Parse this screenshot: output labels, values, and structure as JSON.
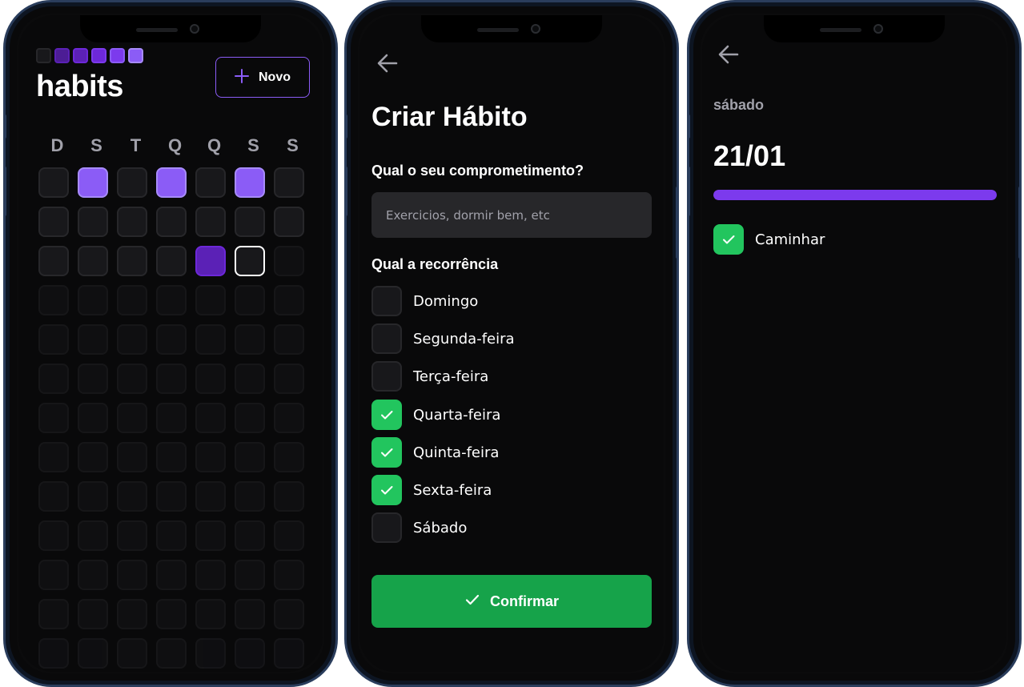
{
  "colors": {
    "accent": "#8b5cf6",
    "accent_dark": "#5b21b6",
    "success": "#22c55e",
    "success_button": "#16a34a",
    "background": "#09090a",
    "cell": "#18181b",
    "cell_border": "#27272a"
  },
  "home": {
    "title": "habits",
    "new_button": {
      "icon": "plus-icon",
      "label": "Novo"
    },
    "weekdays": [
      "D",
      "S",
      "T",
      "Q",
      "Q",
      "S",
      "S"
    ],
    "grid": {
      "columns": 7,
      "rows": 13,
      "cell_states": [
        [
          "empty",
          "light",
          "empty",
          "light",
          "empty",
          "light",
          "empty"
        ],
        [
          "empty",
          "empty",
          "empty",
          "empty",
          "empty",
          "empty",
          "empty"
        ],
        [
          "empty",
          "empty",
          "empty",
          "empty",
          "dark",
          "today",
          "future"
        ]
      ]
    }
  },
  "create": {
    "back_icon": "arrow-left-icon",
    "title": "Criar Hábito",
    "commitment_label": "Qual o seu comprometimento?",
    "commitment_placeholder": "Exercicios, dormir bem, etc",
    "recurrence_label": "Qual a recorrência",
    "days": [
      {
        "label": "Domingo",
        "checked": false
      },
      {
        "label": "Segunda-feira",
        "checked": false
      },
      {
        "label": "Terça-feira",
        "checked": false
      },
      {
        "label": "Quarta-feira",
        "checked": true
      },
      {
        "label": "Quinta-feira",
        "checked": true
      },
      {
        "label": "Sexta-feira",
        "checked": true
      },
      {
        "label": "Sábado",
        "checked": false
      }
    ],
    "confirm_button": {
      "icon": "check-icon",
      "label": "Confirmar"
    }
  },
  "day": {
    "back_icon": "arrow-left-icon",
    "weekday": "sábado",
    "date": "21/01",
    "progress": 1.0,
    "habits": [
      {
        "label": "Caminhar",
        "checked": true
      }
    ]
  }
}
